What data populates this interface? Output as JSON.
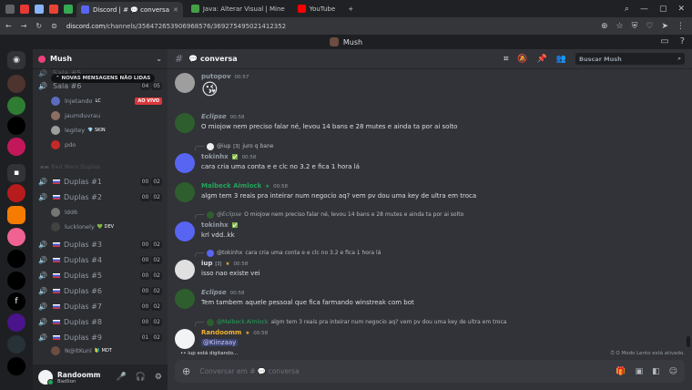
{
  "browser": {
    "tabs": [
      {
        "label": "Discord | # 💬 conversa",
        "active": true
      },
      {
        "label": "Java: Alterar Visual | Mine",
        "active": false
      },
      {
        "label": "YouTube",
        "active": false
      }
    ],
    "new_tab": "+",
    "url_host": "discord.com",
    "url_path": "/channels/356472653906968576/369275495021412352"
  },
  "title_bar": {
    "server_name": "Mush"
  },
  "server": {
    "name": "Mush",
    "new_unread": "NOVAS MENSAGENS NÃO LIDAS",
    "partial_channel_top": "Sala #5",
    "partial_channel": "Sala #6",
    "partial_counts": [
      "04",
      "05"
    ],
    "members_top": [
      {
        "name": "lnjetando",
        "tag": "LC",
        "live": "AO VIVO",
        "color": "#5c6bc0"
      },
      {
        "name": "jaumduvrau",
        "tag": "",
        "live": "",
        "color": "#8d6e63"
      },
      {
        "name": "legitey",
        "tag": "SKIN",
        "live": "",
        "color": "#9e9e9e"
      },
      {
        "name": "pdo",
        "tag": "",
        "live": "",
        "color": "#c62828"
      }
    ],
    "category": "Bed Wars Duplas",
    "channels": [
      {
        "name": "Duplas #1",
        "counts": [
          "00",
          "02"
        ]
      },
      {
        "name": "Duplas #2",
        "counts": [
          "00",
          "02"
        ]
      },
      {
        "name": "Duplas #3",
        "counts": [
          "00",
          "02"
        ]
      },
      {
        "name": "Duplas #4",
        "counts": [
          "00",
          "02"
        ]
      },
      {
        "name": "Duplas #5",
        "counts": [
          "00",
          "02"
        ]
      },
      {
        "name": "Duplas #6",
        "counts": [
          "00",
          "02"
        ]
      },
      {
        "name": "Duplas #7",
        "counts": [
          "00",
          "02"
        ]
      },
      {
        "name": "Duplas #8",
        "counts": [
          "00",
          "02"
        ]
      },
      {
        "name": "Duplas #9",
        "counts": [
          "01",
          "02"
        ]
      }
    ],
    "duplas2_members": [
      {
        "name": "ldd6",
        "tag": "",
        "color": "#757575"
      },
      {
        "name": "lucklonely",
        "tag": "DEV",
        "color": "#424242"
      }
    ],
    "duplas9_member": {
      "name": "N@ItKunl",
      "tag": "MDT",
      "color": "#6d4c41"
    }
  },
  "user": {
    "name": "Randoomm",
    "status": "Badlion"
  },
  "channel": {
    "name": "💬 conversa",
    "search_placeholder": "Buscar Mush",
    "composer_placeholder": "Conversar em # 💬 conversa",
    "typing": "iup está digitando...",
    "slow_mode": "O Modo Lento está ativado."
  },
  "messages": [
    {
      "author": "putopov",
      "time": "00:57",
      "text": "😘",
      "color": "#949ba4"
    },
    {
      "author": "Eclipse",
      "time": "00:58",
      "text": "O miojow nem preciso falar né, levou 14 bans e 28 mutes e ainda ta por ai solto",
      "color": "#949ba4"
    },
    {
      "reply_author": "@iup",
      "reply_tag": "3",
      "reply_text": "juro q bane",
      "author": "tokinhx",
      "time": "00:58",
      "text": "cara cria uma conta e e clc no 3.2 e fica 1 hora lá",
      "color": "#949ba4"
    },
    {
      "author": "Malbeck Aimlock",
      "time": "00:58",
      "text": "algm tem 3 reais pra inteirar num negocio aq? vem pv dou uma key de ultra em troca",
      "color": "#23a55a"
    },
    {
      "reply_author": "@Eclipse",
      "reply_text": "O miojow nem preciso falar né, levou 14 bans e 28 mutes e ainda ta por ai solto",
      "author": "tokinhx",
      "time": "00:58",
      "text": "krl vdd..kk",
      "color": "#949ba4"
    },
    {
      "reply_author": "@tokinhx",
      "reply_text": "cara cria uma conta e e clc no 3.2 e fica 1 hora lá",
      "author": "iup",
      "author_tag": "3",
      "time": "00:58",
      "text": "isso nao existe vei",
      "color": "#dbdee1"
    },
    {
      "author": "Eclipse",
      "time": "00:58",
      "text": "Tem tambem aquele pessoal que fica farmando winstreak com bot",
      "color": "#949ba4"
    },
    {
      "reply_author": "@Malbeck Aimlock",
      "reply_text": "algm tem 3 reais pra inteirar num negocio aq? vem pv dou uma key de ultra em troca",
      "author": "Randoomm",
      "time": "00:58",
      "text": "@Kiinzaay",
      "color": "#f0b232"
    }
  ]
}
